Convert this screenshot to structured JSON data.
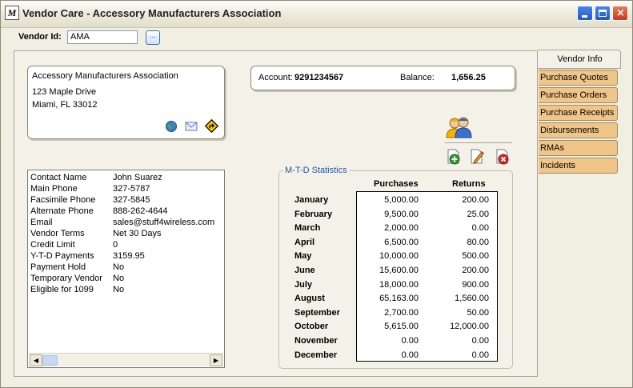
{
  "window": {
    "app_icon": "M",
    "title": "Vendor Care - Accessory Manufacturers Association"
  },
  "vendor": {
    "label": "Vendor Id:",
    "value": "AMA",
    "lookup": "..."
  },
  "address": {
    "name": "Accessory Manufacturers Association",
    "line1": "123 Maple Drive",
    "line2": "Miami, FL 33012"
  },
  "account": {
    "label": "Account:",
    "number": "9291234567",
    "balance_label": "Balance:",
    "balance": "1,656.25"
  },
  "contact": [
    {
      "k": "Contact Name",
      "v": "John Suarez"
    },
    {
      "k": "Main Phone",
      "v": "327-5787"
    },
    {
      "k": "Facsimile Phone",
      "v": "327-5845"
    },
    {
      "k": "Alternate Phone",
      "v": "888-262-4644"
    },
    {
      "k": "Email",
      "v": "sales@stuff4wireless.com"
    },
    {
      "k": "Vendor Terms",
      "v": "Net 30 Days"
    },
    {
      "k": "Credit Limit",
      "v": "0"
    },
    {
      "k": "Y-T-D Payments",
      "v": "3159.95"
    },
    {
      "k": "Payment Hold",
      "v": "No"
    },
    {
      "k": "Temporary Vendor",
      "v": "No"
    },
    {
      "k": "Eligible for 1099",
      "v": "No"
    }
  ],
  "stats": {
    "title": "M-T-D Statistics",
    "col_purchases": "Purchases",
    "col_returns": "Returns",
    "rows": [
      {
        "m": "January",
        "p": "5,000.00",
        "r": "200.00"
      },
      {
        "m": "February",
        "p": "9,500.00",
        "r": "25.00"
      },
      {
        "m": "March",
        "p": "2,000.00",
        "r": "0.00"
      },
      {
        "m": "April",
        "p": "6,500.00",
        "r": "80.00"
      },
      {
        "m": "May",
        "p": "10,000.00",
        "r": "500.00"
      },
      {
        "m": "June",
        "p": "15,600.00",
        "r": "200.00"
      },
      {
        "m": "July",
        "p": "18,000.00",
        "r": "900.00"
      },
      {
        "m": "August",
        "p": "65,163.00",
        "r": "1,560.00"
      },
      {
        "m": "September",
        "p": "2,700.00",
        "r": "50.00"
      },
      {
        "m": "October",
        "p": "5,615.00",
        "r": "12,000.00"
      },
      {
        "m": "November",
        "p": "0.00",
        "r": "0.00"
      },
      {
        "m": "December",
        "p": "0.00",
        "r": "0.00"
      }
    ]
  },
  "tabs": [
    "Vendor Info",
    "Purchase Quotes",
    "Purchase Orders",
    "Purchase Receipts",
    "Disbursements",
    "RMAs",
    "Incidents"
  ],
  "colors": {
    "tab": "#f0c588",
    "accent": "#2155a8"
  }
}
